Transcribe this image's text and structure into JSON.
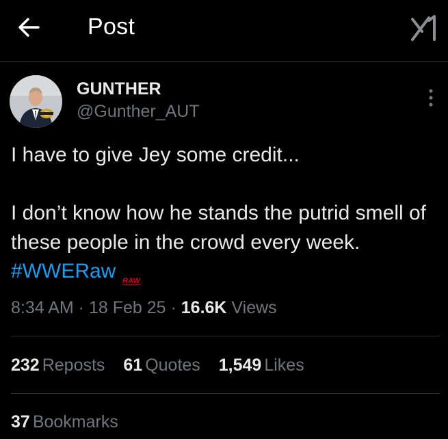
{
  "header": {
    "title": "Post",
    "back_icon": "arrow-left-icon",
    "logo_icon": "x-logo-icon"
  },
  "author": {
    "display_name": "GUNTHER",
    "handle": "@Gunther_AUT"
  },
  "tweet": {
    "line1": "I have to give Jey some credit...",
    "line2": "I don’t know how he stands the putrid smell of these people in the crowd every week. ",
    "hashtag": "#WWERaw",
    "raw_logo_text": "RAW"
  },
  "meta": {
    "time": "8:34 AM",
    "sep1": " · ",
    "date": "18 Feb 25",
    "sep2": " · ",
    "views_count": "16.6K",
    "views_label": " Views"
  },
  "stats": {
    "reposts_count": "232",
    "reposts_label": "Reposts",
    "quotes_count": "61",
    "quotes_label": "Quotes",
    "likes_count": "1,549",
    "likes_label": "Likes",
    "bookmarks_count": "37",
    "bookmarks_label": "Bookmarks"
  },
  "colors": {
    "background": "#000000",
    "text": "#e7e9ea",
    "secondary": "#71767b",
    "link": "#1d9bf0",
    "divider": "#2f3336",
    "raw_red": "#d0021b"
  }
}
